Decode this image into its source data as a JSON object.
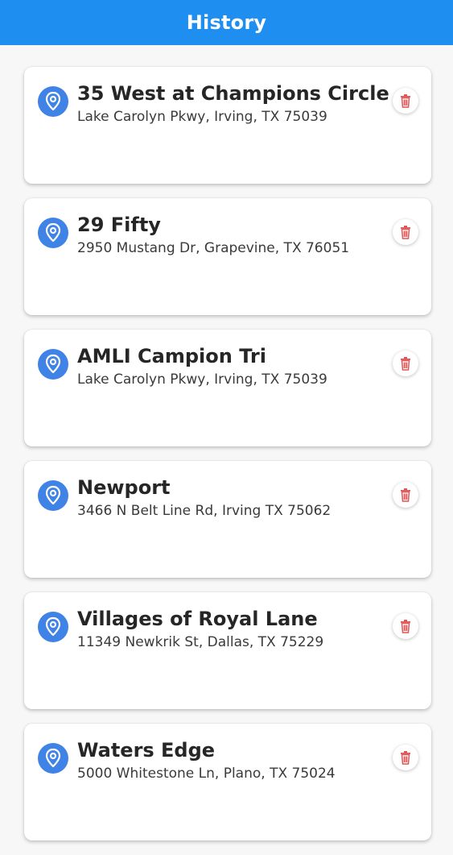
{
  "header": {
    "title": "History"
  },
  "colors": {
    "header_bg": "#1f8ef1",
    "pin_badge": "#3f83e6",
    "delete_icon": "#e05555"
  },
  "history": [
    {
      "name": "35 West at Champions Circle",
      "address": "Lake Carolyn Pkwy, Irving, TX 75039"
    },
    {
      "name": "29 Fifty",
      "address": "2950 Mustang Dr, Grapevine, TX 76051"
    },
    {
      "name": "AMLI Campion Tri",
      "address": "Lake Carolyn Pkwy, Irving, TX 75039"
    },
    {
      "name": "Newport",
      "address": "3466 N Belt Line Rd, Irving TX 75062"
    },
    {
      "name": "Villages of Royal Lane",
      "address": "11349 Newkrik St, Dallas, TX 75229"
    },
    {
      "name": "Waters Edge",
      "address": "5000 Whitestone Ln, Plano, TX 75024"
    }
  ],
  "icons": {
    "location": "location-pin-icon",
    "delete": "trash-icon"
  }
}
